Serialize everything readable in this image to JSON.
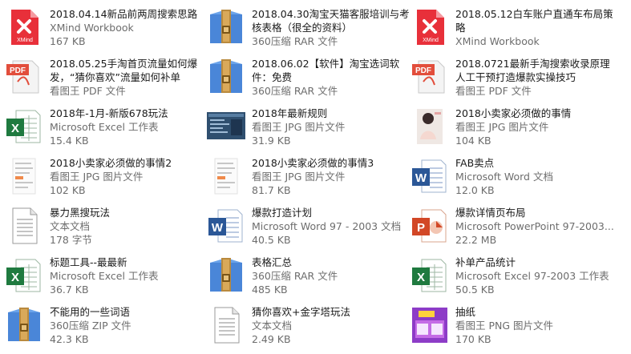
{
  "files": [
    {
      "name": "2018.04.14新品前两周搜索思路",
      "type": "XMind Workbook",
      "size": "167 KB",
      "icon": "xmind-icon"
    },
    {
      "name": "2018.04.30淘宝天猫客服培训与考核表格（很全的资料）",
      "type": "360压缩 RAR 文件",
      "size": "",
      "icon": "archive-icon"
    },
    {
      "name": "2018.05.12白车账户直通车布局策略",
      "type": "XMind Workbook",
      "size": "",
      "icon": "xmind-icon"
    },
    {
      "name": "2018.05.25手淘首页流量如何爆发，“猜你喜欢”流量如何补单",
      "type": "看图王 PDF 文件",
      "size": "",
      "icon": "pdf-icon"
    },
    {
      "name": "2018.06.02【软件】淘宝选词软件：免费",
      "type": "360压缩 RAR 文件",
      "size": "",
      "icon": "archive-icon"
    },
    {
      "name": "2018.0721最新手淘搜索收录原理人工干预打造爆款实操技巧",
      "type": "看图王 PDF 文件",
      "size": "",
      "icon": "pdf-icon"
    },
    {
      "name": "2018年-1月-新版678玩法",
      "type": "Microsoft Excel 工作表",
      "size": "15.4 KB",
      "icon": "excel-icon"
    },
    {
      "name": "2018年最新规则",
      "type": "看图王 JPG 图片文件",
      "size": "31.9 KB",
      "icon": "image-thumbnail-icon"
    },
    {
      "name": "2018小卖家必须做的事情",
      "type": "看图王 JPG 图片文件",
      "size": "104 KB",
      "icon": "photo-thumbnail-icon"
    },
    {
      "name": "2018小卖家必须做的事情2",
      "type": "看图王 JPG 图片文件",
      "size": "102 KB",
      "icon": "doc-thumbnail-icon"
    },
    {
      "name": "2018小卖家必须做的事情3",
      "type": "看图王 JPG 图片文件",
      "size": "81.7 KB",
      "icon": "doc-thumbnail-icon"
    },
    {
      "name": "FAB卖点",
      "type": "Microsoft Word 文档",
      "size": "12.0 KB",
      "icon": "word-icon"
    },
    {
      "name": "暴力黑搜玩法",
      "type": "文本文档",
      "size": "178 字节",
      "icon": "text-file-icon"
    },
    {
      "name": "爆款打造计划",
      "type": "Microsoft Word 97 - 2003 文档",
      "size": "40.5 KB",
      "icon": "word-icon"
    },
    {
      "name": "爆款详情页布局",
      "type": "Microsoft PowerPoint 97-2003...",
      "size": "22.2 MB",
      "icon": "powerpoint-icon"
    },
    {
      "name": "标题工具--最最新",
      "type": "Microsoft Excel 工作表",
      "size": "36.7 KB",
      "icon": "excel-icon"
    },
    {
      "name": "表格汇总",
      "type": "360压缩 RAR 文件",
      "size": "485 KB",
      "icon": "archive-icon"
    },
    {
      "name": "补单产品统计",
      "type": "Microsoft Excel 97-2003 工作表",
      "size": "50.5 KB",
      "icon": "excel-icon"
    },
    {
      "name": "不能用的一些词语",
      "type": "360压缩 ZIP 文件",
      "size": "42.3 KB",
      "icon": "archive-icon"
    },
    {
      "name": "猜你喜欢+金字塔玩法",
      "type": "文本文档",
      "size": "2.49 KB",
      "icon": "text-file-icon"
    },
    {
      "name": "抽纸",
      "type": "看图王 PNG 图片文件",
      "size": "170 KB",
      "icon": "product-thumbnail-icon"
    }
  ]
}
